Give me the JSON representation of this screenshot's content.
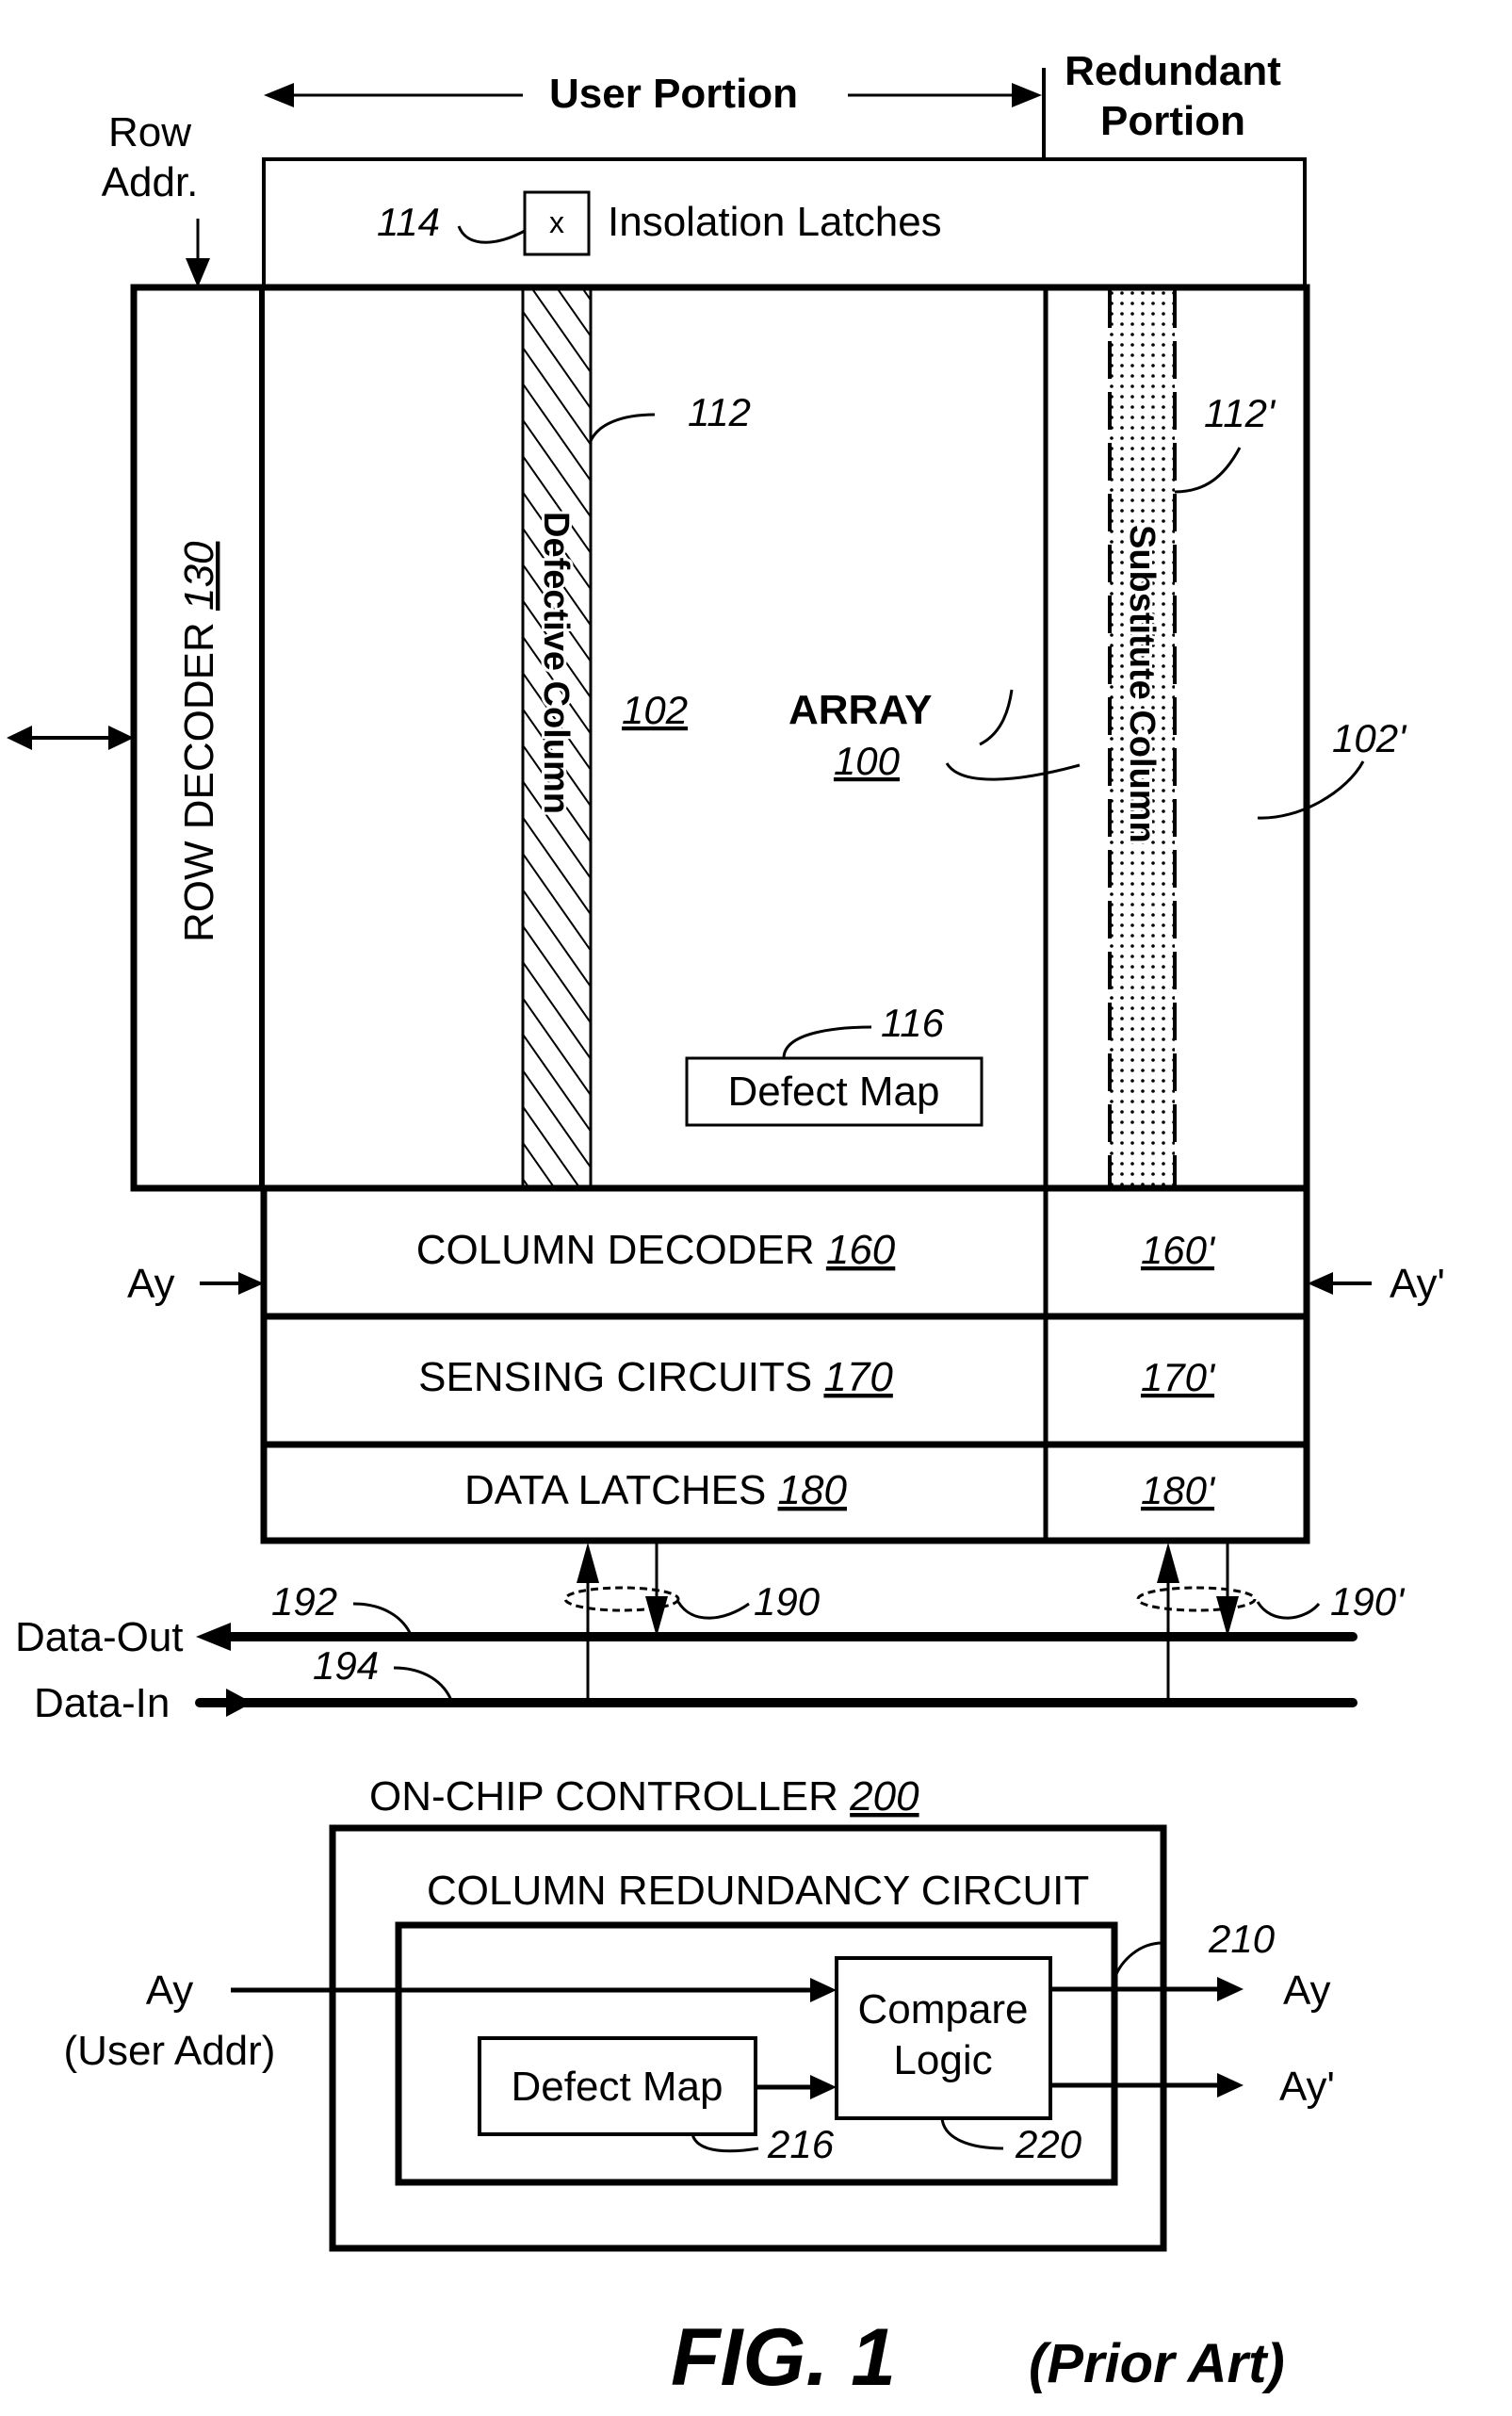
{
  "figure": {
    "title": "FIG. 1",
    "subtitle": "(Prior Art)"
  },
  "header": {
    "user_portion": "User Portion",
    "redundant_line1": "Redundant",
    "redundant_line2": "Portion",
    "row_addr_line1": "Row",
    "row_addr_line2": "Addr."
  },
  "isolation": {
    "ref": "114",
    "latch_symbol": "x",
    "label": "Insolation Latches"
  },
  "row_decoder": {
    "label": "ROW DECODER ",
    "ref": "130"
  },
  "array": {
    "defective_column": {
      "label": "Defective Column",
      "ref": "112"
    },
    "user_block_ref": "102",
    "array_label": "ARRAY",
    "array_ref": "100",
    "substitute_column": {
      "label": "Substitute Column",
      "ref": "112'"
    },
    "redundant_block_ref": "102'",
    "defect_map": {
      "label": "Defect Map",
      "ref": "116"
    }
  },
  "peripheral_rows": [
    {
      "label": "COLUMN DECODER ",
      "ref": "160",
      "redundant_ref": "160'"
    },
    {
      "label": "SENSING CIRCUITS ",
      "ref": "170",
      "redundant_ref": "170'"
    },
    {
      "label": "DATA LATCHES ",
      "ref": "180",
      "redundant_ref": "180'"
    }
  ],
  "signals": {
    "ay_in_left": "Ay",
    "ay_in_right": "Ay'",
    "data_out": "Data-Out",
    "data_in": "Data-In",
    "data_out_ref": "192",
    "data_in_ref": "194",
    "bus_ref": "190",
    "bus_ref_redundant": "190'"
  },
  "controller": {
    "title": "ON-CHIP CONTROLLER ",
    "ref": "200",
    "circuit_title": "COLUMN REDUNDANCY CIRCUIT",
    "circuit_ref": "210",
    "input_label": "Ay",
    "input_sublabel": "(User Addr)",
    "compare_line1": "Compare",
    "compare_line2": "Logic",
    "compare_ref": "220",
    "defect_map_label": "Defect Map",
    "defect_map_ref": "216",
    "output_ay": "Ay",
    "output_ay_prime": "Ay'"
  }
}
